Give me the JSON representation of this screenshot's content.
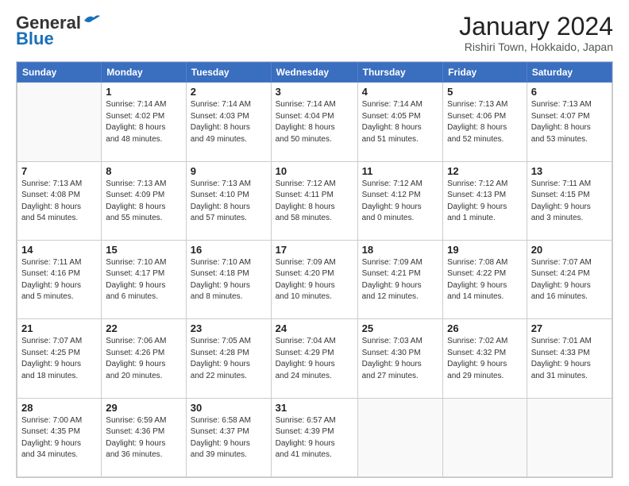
{
  "header": {
    "logo_general": "General",
    "logo_blue": "Blue",
    "month_title": "January 2024",
    "subtitle": "Rishiri Town, Hokkaido, Japan"
  },
  "days": [
    "Sunday",
    "Monday",
    "Tuesday",
    "Wednesday",
    "Thursday",
    "Friday",
    "Saturday"
  ],
  "weeks": [
    [
      {
        "date": "",
        "info": ""
      },
      {
        "date": "1",
        "info": "Sunrise: 7:14 AM\nSunset: 4:02 PM\nDaylight: 8 hours\nand 48 minutes."
      },
      {
        "date": "2",
        "info": "Sunrise: 7:14 AM\nSunset: 4:03 PM\nDaylight: 8 hours\nand 49 minutes."
      },
      {
        "date": "3",
        "info": "Sunrise: 7:14 AM\nSunset: 4:04 PM\nDaylight: 8 hours\nand 50 minutes."
      },
      {
        "date": "4",
        "info": "Sunrise: 7:14 AM\nSunset: 4:05 PM\nDaylight: 8 hours\nand 51 minutes."
      },
      {
        "date": "5",
        "info": "Sunrise: 7:13 AM\nSunset: 4:06 PM\nDaylight: 8 hours\nand 52 minutes."
      },
      {
        "date": "6",
        "info": "Sunrise: 7:13 AM\nSunset: 4:07 PM\nDaylight: 8 hours\nand 53 minutes."
      }
    ],
    [
      {
        "date": "7",
        "info": "Sunrise: 7:13 AM\nSunset: 4:08 PM\nDaylight: 8 hours\nand 54 minutes."
      },
      {
        "date": "8",
        "info": "Sunrise: 7:13 AM\nSunset: 4:09 PM\nDaylight: 8 hours\nand 55 minutes."
      },
      {
        "date": "9",
        "info": "Sunrise: 7:13 AM\nSunset: 4:10 PM\nDaylight: 8 hours\nand 57 minutes."
      },
      {
        "date": "10",
        "info": "Sunrise: 7:12 AM\nSunset: 4:11 PM\nDaylight: 8 hours\nand 58 minutes."
      },
      {
        "date": "11",
        "info": "Sunrise: 7:12 AM\nSunset: 4:12 PM\nDaylight: 9 hours\nand 0 minutes."
      },
      {
        "date": "12",
        "info": "Sunrise: 7:12 AM\nSunset: 4:13 PM\nDaylight: 9 hours\nand 1 minute."
      },
      {
        "date": "13",
        "info": "Sunrise: 7:11 AM\nSunset: 4:15 PM\nDaylight: 9 hours\nand 3 minutes."
      }
    ],
    [
      {
        "date": "14",
        "info": "Sunrise: 7:11 AM\nSunset: 4:16 PM\nDaylight: 9 hours\nand 5 minutes."
      },
      {
        "date": "15",
        "info": "Sunrise: 7:10 AM\nSunset: 4:17 PM\nDaylight: 9 hours\nand 6 minutes."
      },
      {
        "date": "16",
        "info": "Sunrise: 7:10 AM\nSunset: 4:18 PM\nDaylight: 9 hours\nand 8 minutes."
      },
      {
        "date": "17",
        "info": "Sunrise: 7:09 AM\nSunset: 4:20 PM\nDaylight: 9 hours\nand 10 minutes."
      },
      {
        "date": "18",
        "info": "Sunrise: 7:09 AM\nSunset: 4:21 PM\nDaylight: 9 hours\nand 12 minutes."
      },
      {
        "date": "19",
        "info": "Sunrise: 7:08 AM\nSunset: 4:22 PM\nDaylight: 9 hours\nand 14 minutes."
      },
      {
        "date": "20",
        "info": "Sunrise: 7:07 AM\nSunset: 4:24 PM\nDaylight: 9 hours\nand 16 minutes."
      }
    ],
    [
      {
        "date": "21",
        "info": "Sunrise: 7:07 AM\nSunset: 4:25 PM\nDaylight: 9 hours\nand 18 minutes."
      },
      {
        "date": "22",
        "info": "Sunrise: 7:06 AM\nSunset: 4:26 PM\nDaylight: 9 hours\nand 20 minutes."
      },
      {
        "date": "23",
        "info": "Sunrise: 7:05 AM\nSunset: 4:28 PM\nDaylight: 9 hours\nand 22 minutes."
      },
      {
        "date": "24",
        "info": "Sunrise: 7:04 AM\nSunset: 4:29 PM\nDaylight: 9 hours\nand 24 minutes."
      },
      {
        "date": "25",
        "info": "Sunrise: 7:03 AM\nSunset: 4:30 PM\nDaylight: 9 hours\nand 27 minutes."
      },
      {
        "date": "26",
        "info": "Sunrise: 7:02 AM\nSunset: 4:32 PM\nDaylight: 9 hours\nand 29 minutes."
      },
      {
        "date": "27",
        "info": "Sunrise: 7:01 AM\nSunset: 4:33 PM\nDaylight: 9 hours\nand 31 minutes."
      }
    ],
    [
      {
        "date": "28",
        "info": "Sunrise: 7:00 AM\nSunset: 4:35 PM\nDaylight: 9 hours\nand 34 minutes."
      },
      {
        "date": "29",
        "info": "Sunrise: 6:59 AM\nSunset: 4:36 PM\nDaylight: 9 hours\nand 36 minutes."
      },
      {
        "date": "30",
        "info": "Sunrise: 6:58 AM\nSunset: 4:37 PM\nDaylight: 9 hours\nand 39 minutes."
      },
      {
        "date": "31",
        "info": "Sunrise: 6:57 AM\nSunset: 4:39 PM\nDaylight: 9 hours\nand 41 minutes."
      },
      {
        "date": "",
        "info": ""
      },
      {
        "date": "",
        "info": ""
      },
      {
        "date": "",
        "info": ""
      }
    ]
  ]
}
